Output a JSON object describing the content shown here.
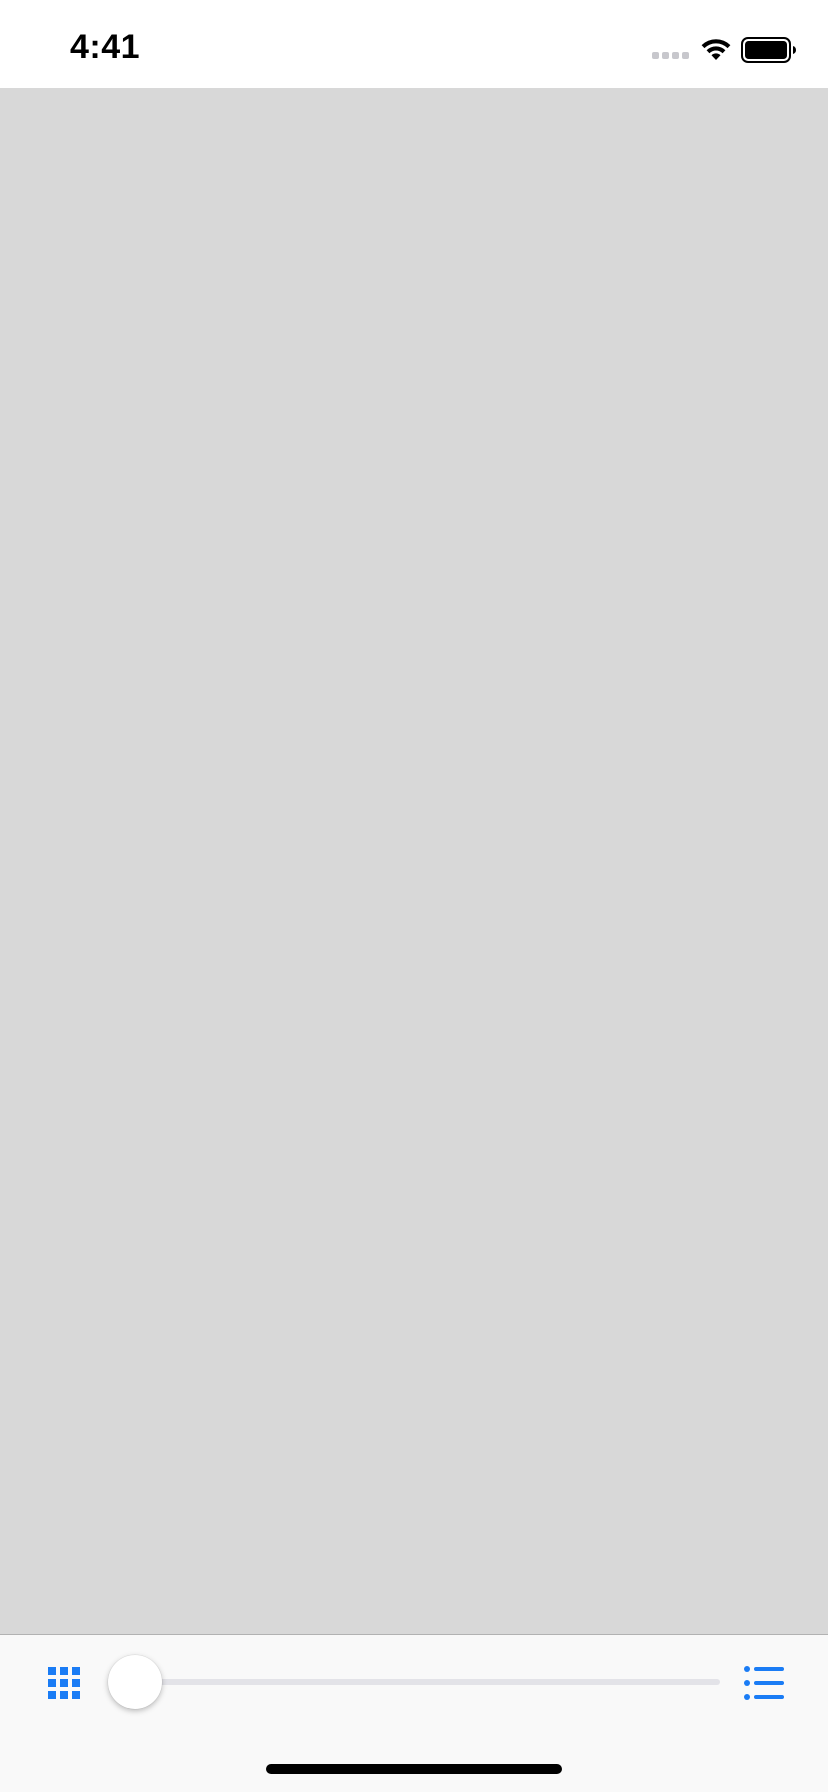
{
  "status_bar": {
    "time": "4:41",
    "icons": [
      "cellular-signal-icon",
      "wifi-icon",
      "battery-icon"
    ]
  },
  "content": {
    "background_color": "#d8d8d8"
  },
  "toolbar": {
    "left_button_icon": "grid-icon",
    "right_button_icon": "list-icon",
    "slider_value": 0.0,
    "accent_color": "#1a7cf5"
  }
}
